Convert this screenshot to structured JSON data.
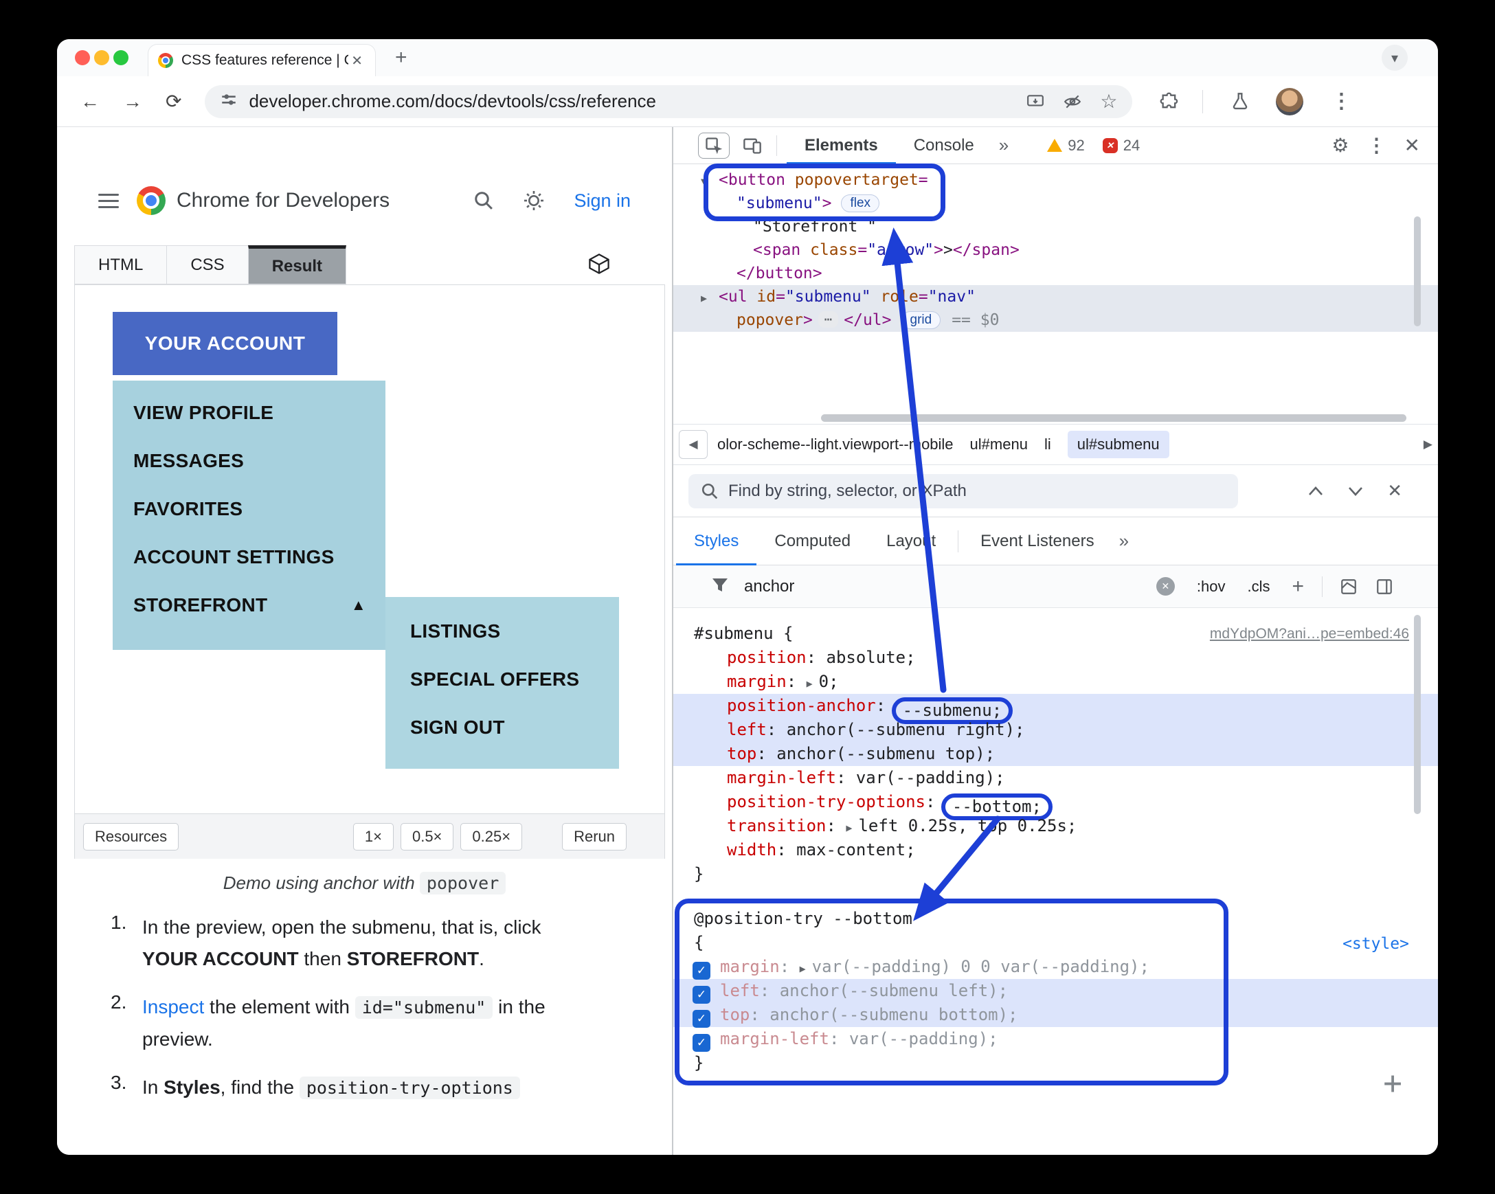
{
  "window": {
    "tab_title": "CSS features reference  |  Chr",
    "url": "developer.chrome.com/docs/devtools/css/reference"
  },
  "site": {
    "brand": "Chrome for Developers",
    "sign_in": "Sign in",
    "code_tabs": [
      "HTML",
      "CSS",
      "Result"
    ],
    "selected_code_tab": "Result",
    "demo": {
      "account": "YOUR ACCOUNT",
      "menu": [
        "VIEW PROFILE",
        "MESSAGES",
        "FAVORITES",
        "ACCOUNT SETTINGS",
        "STOREFRONT"
      ],
      "storefront_arrow": "▲",
      "submenu": [
        "LISTINGS",
        "SPECIAL OFFERS",
        "SIGN OUT"
      ],
      "resources": "Resources",
      "scales": [
        "1×",
        "0.5×",
        "0.25×"
      ],
      "rerun": "Rerun"
    },
    "caption": [
      {
        "t": "Demo using anchor with ",
        "style": "italic"
      },
      {
        "t": "popover",
        "style": "code"
      }
    ],
    "steps": [
      {
        "num": "1.",
        "segments": [
          {
            "t": "In the preview, open the submenu, that is, click "
          },
          {
            "t": "YOUR ACCOUNT",
            "style": "bold"
          },
          {
            "t": " then "
          },
          {
            "t": "STOREFRONT",
            "style": "bold"
          },
          {
            "t": "."
          }
        ]
      },
      {
        "num": "2.",
        "segments": [
          {
            "t": "Inspect",
            "style": "link"
          },
          {
            "t": " the element with "
          },
          {
            "t": "id=\"submenu\"",
            "style": "code"
          },
          {
            "t": " in the preview."
          }
        ]
      },
      {
        "num": "3.",
        "segments": [
          {
            "t": "In "
          },
          {
            "t": "Styles",
            "style": "bold"
          },
          {
            "t": ", find the "
          },
          {
            "t": "position-try-options",
            "style": "code"
          }
        ]
      }
    ]
  },
  "devtools": {
    "tabs": [
      "Elements",
      "Console"
    ],
    "more": "»",
    "warnings": "92",
    "errors": "24",
    "tree": [
      {
        "pad": 40,
        "marker": "▼",
        "pre": [
          {
            "t": "<button ",
            "c": "tag"
          },
          {
            "t": "popovertarget",
            "c": "attr"
          },
          {
            "t": "=",
            "c": "tag"
          }
        ]
      },
      {
        "pad": 92,
        "pre": [
          {
            "t": "\"submenu\"",
            "c": "val"
          },
          {
            "t": ">",
            "c": "tag"
          }
        ],
        "badge": "flex"
      },
      {
        "pad": 116,
        "pre": [
          {
            "t": "\"Storefront \"",
            "c": "text"
          }
        ]
      },
      {
        "pad": 116,
        "pre": [
          {
            "t": "<span ",
            "c": "tag"
          },
          {
            "t": "class",
            "c": "attr"
          },
          {
            "t": "=",
            "c": "tag"
          },
          {
            "t": "\"arrow\"",
            "c": "val"
          },
          {
            "t": ">",
            "c": "tag"
          },
          {
            "t": ">",
            "c": "text"
          },
          {
            "t": "</span>",
            "c": "tag"
          }
        ]
      },
      {
        "pad": 92,
        "pre": [
          {
            "t": "</button>",
            "c": "tag"
          }
        ]
      },
      {
        "pad": 40,
        "marker": "▶",
        "sel": true,
        "pre": [
          {
            "t": "<ul ",
            "c": "tag"
          },
          {
            "t": "id",
            "c": "attr"
          },
          {
            "t": "=",
            "c": "tag"
          },
          {
            "t": "\"submenu\"",
            "c": "val"
          },
          {
            "t": " ",
            "c": "tag"
          },
          {
            "t": "role",
            "c": "attr"
          },
          {
            "t": "=",
            "c": "tag"
          },
          {
            "t": "\"nav\"",
            "c": "val"
          }
        ]
      },
      {
        "pad": 92,
        "sel": true,
        "pre": [
          {
            "t": "popover",
            "c": "attr"
          },
          {
            "t": ">",
            "c": "tag"
          }
        ],
        "ell": true,
        "post": [
          {
            "t": "</ul>",
            "c": "tag"
          }
        ],
        "badge": "grid",
        "suffix": "== $0"
      }
    ],
    "crumbs": [
      {
        "t": "olor-scheme--light.viewport--mobile"
      },
      {
        "t": "ul#menu"
      },
      {
        "t": "li"
      },
      {
        "t": "ul#submenu",
        "sel": true
      }
    ],
    "find_placeholder": "Find by string, selector, or XPath",
    "side_tabs": [
      "Styles",
      "Computed",
      "Layout",
      "Event Listeners"
    ],
    "side_more": "»",
    "filter_value": "anchor",
    "hov": ":hov",
    "cls": ".cls",
    "plus": "+",
    "rule1": {
      "selector": "#submenu",
      "open": "{",
      "close": "}",
      "link": "mdYdpOM?ani…pe=embed:46",
      "decls": [
        {
          "name": "position",
          "value": "absolute"
        },
        {
          "name": "margin",
          "value": "0",
          "arrow": true
        },
        {
          "name": "position-anchor",
          "value": "--submenu",
          "hl": true,
          "circle": true
        },
        {
          "name": "left",
          "value": "anchor(--submenu right)",
          "hl": true
        },
        {
          "name": "top",
          "value": "anchor(--submenu top)",
          "hl": true
        },
        {
          "name": "margin-left",
          "value": "var(--padding)"
        },
        {
          "name": "position-try-options",
          "value": "--bottom",
          "circle": true
        },
        {
          "name": "transition",
          "value": "left 0.25s, top 0.25s",
          "arrow": true
        },
        {
          "name": "width",
          "value": "max-content"
        }
      ]
    },
    "rule2": {
      "at": "@position-try --bottom",
      "open": "{",
      "close": "}",
      "link": "<style>",
      "decls": [
        {
          "name": "margin",
          "value": "var(--padding) 0 0 var(--padding)",
          "arrow": true,
          "checked": true
        },
        {
          "name": "left",
          "value": "anchor(--submenu left)",
          "checked": true,
          "hl": true
        },
        {
          "name": "top",
          "value": "anchor(--submenu bottom)",
          "checked": true,
          "hl": true
        },
        {
          "name": "margin-left",
          "value": "var(--padding)",
          "checked": true
        }
      ]
    }
  }
}
